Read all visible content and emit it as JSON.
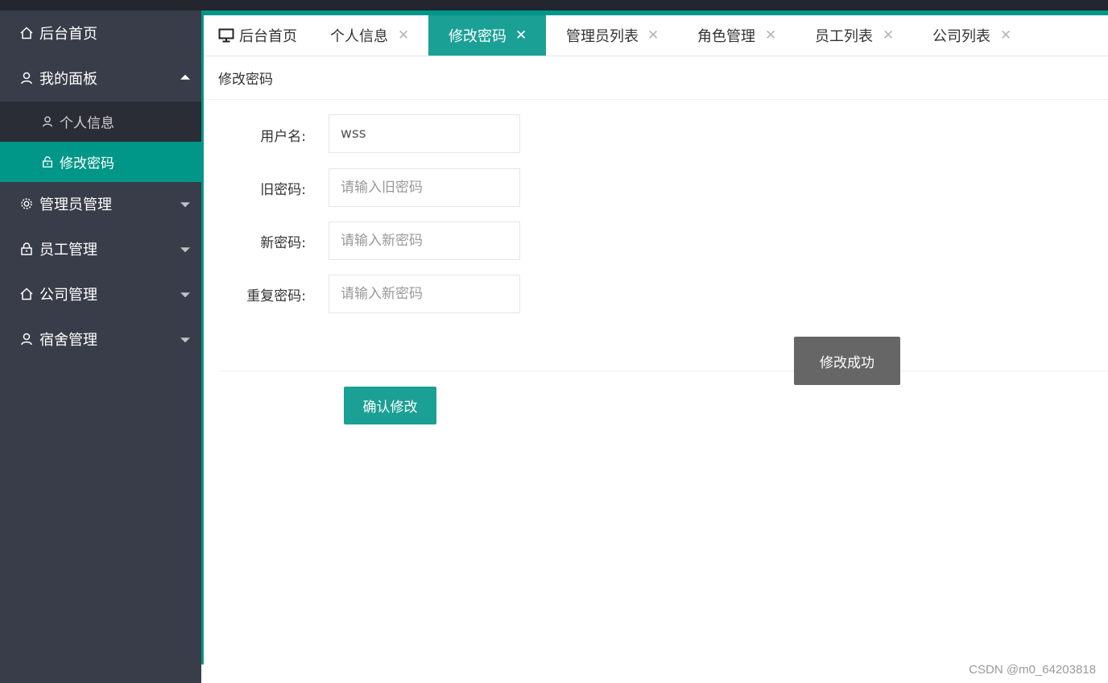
{
  "sidebar": {
    "items": [
      {
        "label": "后台首页",
        "icon": "home-icon"
      },
      {
        "label": "我的面板",
        "icon": "user-icon",
        "expanded": true,
        "children": [
          {
            "label": "个人信息",
            "icon": "user-icon",
            "active": false
          },
          {
            "label": "修改密码",
            "icon": "lock-icon",
            "active": true
          }
        ]
      },
      {
        "label": "管理员管理",
        "icon": "gear-icon"
      },
      {
        "label": "员工管理",
        "icon": "lock-icon"
      },
      {
        "label": "公司管理",
        "icon": "home-icon"
      },
      {
        "label": "宿舍管理",
        "icon": "user-icon"
      }
    ]
  },
  "tabs": [
    {
      "label": "后台首页",
      "icon": "monitor-icon",
      "closable": false
    },
    {
      "label": "个人信息",
      "closable": true
    },
    {
      "label": "修改密码",
      "closable": true,
      "active": true
    },
    {
      "label": "管理员列表",
      "closable": true
    },
    {
      "label": "角色管理",
      "closable": true
    },
    {
      "label": "员工列表",
      "closable": true
    },
    {
      "label": "公司列表",
      "closable": true
    }
  ],
  "close_glyph": "✕",
  "breadcrumb": "修改密码",
  "form": {
    "username": {
      "label": "用户名:",
      "value": "wss"
    },
    "old_password": {
      "label": "旧密码:",
      "placeholder": "请输入旧密码"
    },
    "new_password": {
      "label": "新密码:",
      "placeholder": "请输入新密码"
    },
    "repeat_password": {
      "label": "重复密码:",
      "placeholder": "请输入新密码"
    },
    "submit_label": "确认修改"
  },
  "toast": "修改成功",
  "watermark": "CSDN @m0_64203818",
  "colors": {
    "accent": "#009688",
    "accent_tab": "#1aa094",
    "sidebar_bg": "#393d49",
    "submenu_bg": "#2a2d36",
    "topbar": "#23262e",
    "toast_bg": "#666666"
  }
}
